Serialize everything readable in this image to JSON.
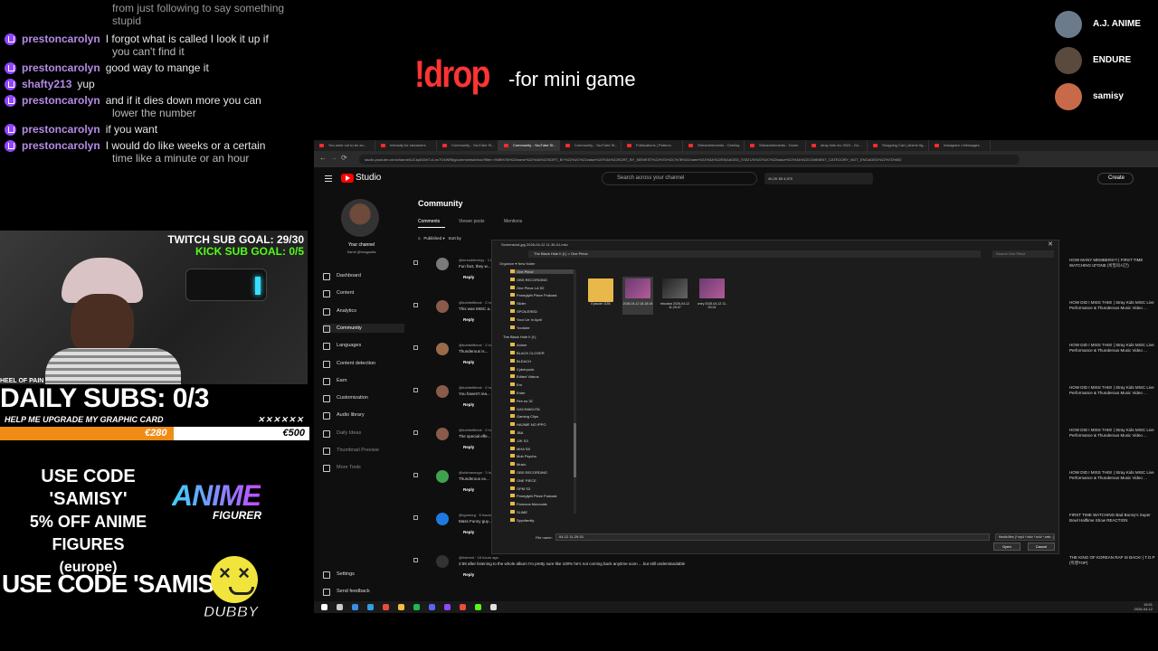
{
  "chat": {
    "top_fragment": [
      "from just following to say something",
      "stupid"
    ],
    "messages": [
      {
        "user": "prestoncarolyn",
        "text": "I forgot what is called I look it up if",
        "cont": "you can't find it"
      },
      {
        "user": "prestoncarolyn",
        "text": "good way to mange it",
        "cont": ""
      },
      {
        "user": "shafty213",
        "text": "yup",
        "cont": ""
      },
      {
        "user": "prestoncarolyn",
        "text": "and if it dies down more you can",
        "cont": "lower the number"
      },
      {
        "user": "prestoncarolyn",
        "text": "if you want",
        "cont": ""
      },
      {
        "user": "prestoncarolyn",
        "text": "I would do like weeks or a certain",
        "cont": "time like a minute or an hour"
      }
    ]
  },
  "overlay": {
    "twitch_goal": "TWITCH SUB GOAL: 29/30",
    "kick_goal": "KICK SUB GOAL: 0/5",
    "wheel_label": "HEEL OF PAIN",
    "daily_subs": "DAILY SUBS: 0/3",
    "upgrade_text": "HELP ME UPGRADE MY GRAPHIC CARD",
    "progress_current": "€280",
    "progress_target": "€500",
    "progress_fraction": 0.56,
    "promo1_line1": "USE CODE 'SAMISY'",
    "promo1_line2": "5% OFF ANIME FIGURES",
    "promo1_line3": "(europe)",
    "anime_logo_main": "ANIME",
    "anime_logo_sub": "FIGURER",
    "promo2": "USE CODE 'SAMISY'",
    "dubby_logo": "DUBBY",
    "drop_command": "!drop",
    "drop_desc": "-for mini game",
    "accent_orange": "#f08c16",
    "twitch_purple": "#9146ff",
    "kick_green": "#53fc18"
  },
  "viewers": [
    "A.J. ANIME",
    "ENDURE",
    "samisy"
  ],
  "browser": {
    "tabs": [
      "You were not to be an...",
      "Intensity for streamers",
      "Community - YouTube St...",
      "Community - YouTube St...",
      "Community - YouTube St...",
      "Publications | Patreon",
      "Streamelements - Overlay",
      "Streamelements - Home",
      "stray kids mv 2023 - Go...",
      "Shopping Cart | Anime fig...",
      "Instagram • Messages"
    ],
    "url": "studio.youtube.com/channel/UCkp034bT-ct-nv7G4WR8g/comments/inbox?filter=%5B%7B%22name%22%3A%22SORT_BY%22%2C%22value%22%3A%22SORT_BY_NEWEST%22%7D%2C%7B%22name%22%3A%22ENGAGED_STATUS%22%2C%22value%22%3A%22COMMENT_CATEGORY_NOT_ENGAGED%22%7D%5D"
  },
  "studio": {
    "logo_label": "Studio",
    "search_placeholder": "Search across your channel",
    "stats": "40.2K   65   4,570",
    "create_label": "Create",
    "your_channel": "Your channel",
    "channel_handle": "Samil @hosgsatis",
    "nav": [
      "Dashboard",
      "Content",
      "Analytics",
      "Community",
      "Languages",
      "Content detection",
      "Earn",
      "Customization",
      "Audio library",
      "Daily Ideas",
      "Thumbnail Preview",
      "More Tools"
    ],
    "nav_bottom": [
      "Settings",
      "Send feedback"
    ],
    "page_title": "Community",
    "tabs": [
      "Comments",
      "Viewer posts",
      "Mentions"
    ],
    "filter_label": "Published",
    "sort_label": "Sort by",
    "reply_label": "Reply",
    "comments": [
      {
        "author": "@mrsoddermyy · 1 hour ago",
        "text": "Fun fact, they w..."
      },
      {
        "author": "@bobbelfbeck · 2 hours ago",
        "text": "This was MISC a..."
      },
      {
        "author": "@bobbelfbeck · 2 hours ago",
        "text": "Thunderous is..."
      },
      {
        "author": "@bobbelfbeck · 2 hours ago",
        "text": "You haven't rea..."
      },
      {
        "author": "@bobbelfbeck · 2 hours ago",
        "text": "The special effe..."
      },
      {
        "author": "@oldmacnogo · 3 hours ago",
        "text": "Thunderous ex..."
      },
      {
        "author": "@rgomorg · 5 hours ago",
        "text": "Mass Funny guy..."
      },
      {
        "author": "@hsbmol · 16 hours ago",
        "text": "2:59 after listening to the whole album I'm pretty sure like 100% he's not coming back anytime soon ... but still understandable"
      }
    ],
    "replies_label": "0 replies",
    "video_titles": [
      "HOW MANY MEMBERS?! | FIRST TIME WATCHING IZ*ONE (비밀의시간)",
      "HOW DID I MISS THIS! | Stray Kids MISC Live Performance & Thunderous Music Video ...",
      "HOW DID I MISS THIS! | Stray Kids MISC Live Performance & Thunderous Music Video ...",
      "HOW DID I MISS THIS! | Stray Kids MISC Live Performance & Thunderous Music Video ...",
      "HOW DID I MISS THIS! | Stray Kids MISC Live Performance & Thunderous Music Video ...",
      "HOW DID I MISS THIS! | Stray Kids MISC Live Performance & Thunderous Music Video ...",
      "FIRST TIME WATCHING Bad Bunny's Super Bowl Halftime Show REACTION",
      "THE KING OF KOREAN RAP IS BACK! | T.O.P (빅뱅TOP)"
    ]
  },
  "dialog": {
    "title": "Screenshot-jpg 2026-04-12 11-30-01.mkv",
    "path": "The Black Hole II (I:)  >  One Piece",
    "search_placeholder": "Search One Piece",
    "toolbar": "Organize ▾    New folder",
    "tree_quick": [
      "One Piece",
      "OBS RECORDING",
      "One Piece LA S2",
      "Poneglyth Piece Podcast",
      "Slider",
      "SPOILERED",
      "Your Lie In April",
      "Youtube"
    ],
    "tree_drive": "The Black Hole II (I:)",
    "tree_items": [
      "Anime",
      "BLACK CLOVER",
      "BLEACH",
      "Cyberpunk",
      "Edited Videos",
      "Em",
      "Enter",
      "Fire es 32",
      "GACHIAKUTA",
      "Gaming Clips",
      "HAJIME NO IPPO",
      "JBA",
      "JJK S3",
      "MHA S8",
      "Mob Psycho",
      "Music",
      "OBS RECORDING",
      "ONE PIECE",
      "OPM S3",
      "Poneglyth Piece Podcast",
      "Ponezos Movocals",
      "SLIME",
      "Spyxfamily"
    ],
    "files": [
      {
        "name": "Episode 1156",
        "kind": "folder"
      },
      {
        "name": "2026-04-12 18-18-06",
        "kind": "video"
      },
      {
        "name": "ebookvs 2026-04-12 11-29-07",
        "kind": "dark"
      },
      {
        "name": "cmry 2026-04-12 11-29-01",
        "kind": "video"
      }
    ],
    "filename_label": "File name:",
    "filename_value": "04-12 11-29-01",
    "filetype": "Media files (*.mp4 *.mkv *.m4v *.web...)",
    "open_label": "Open",
    "cancel_label": "Cancel"
  },
  "taskbar": {
    "time": "15:51",
    "date": "2026-04-12"
  }
}
